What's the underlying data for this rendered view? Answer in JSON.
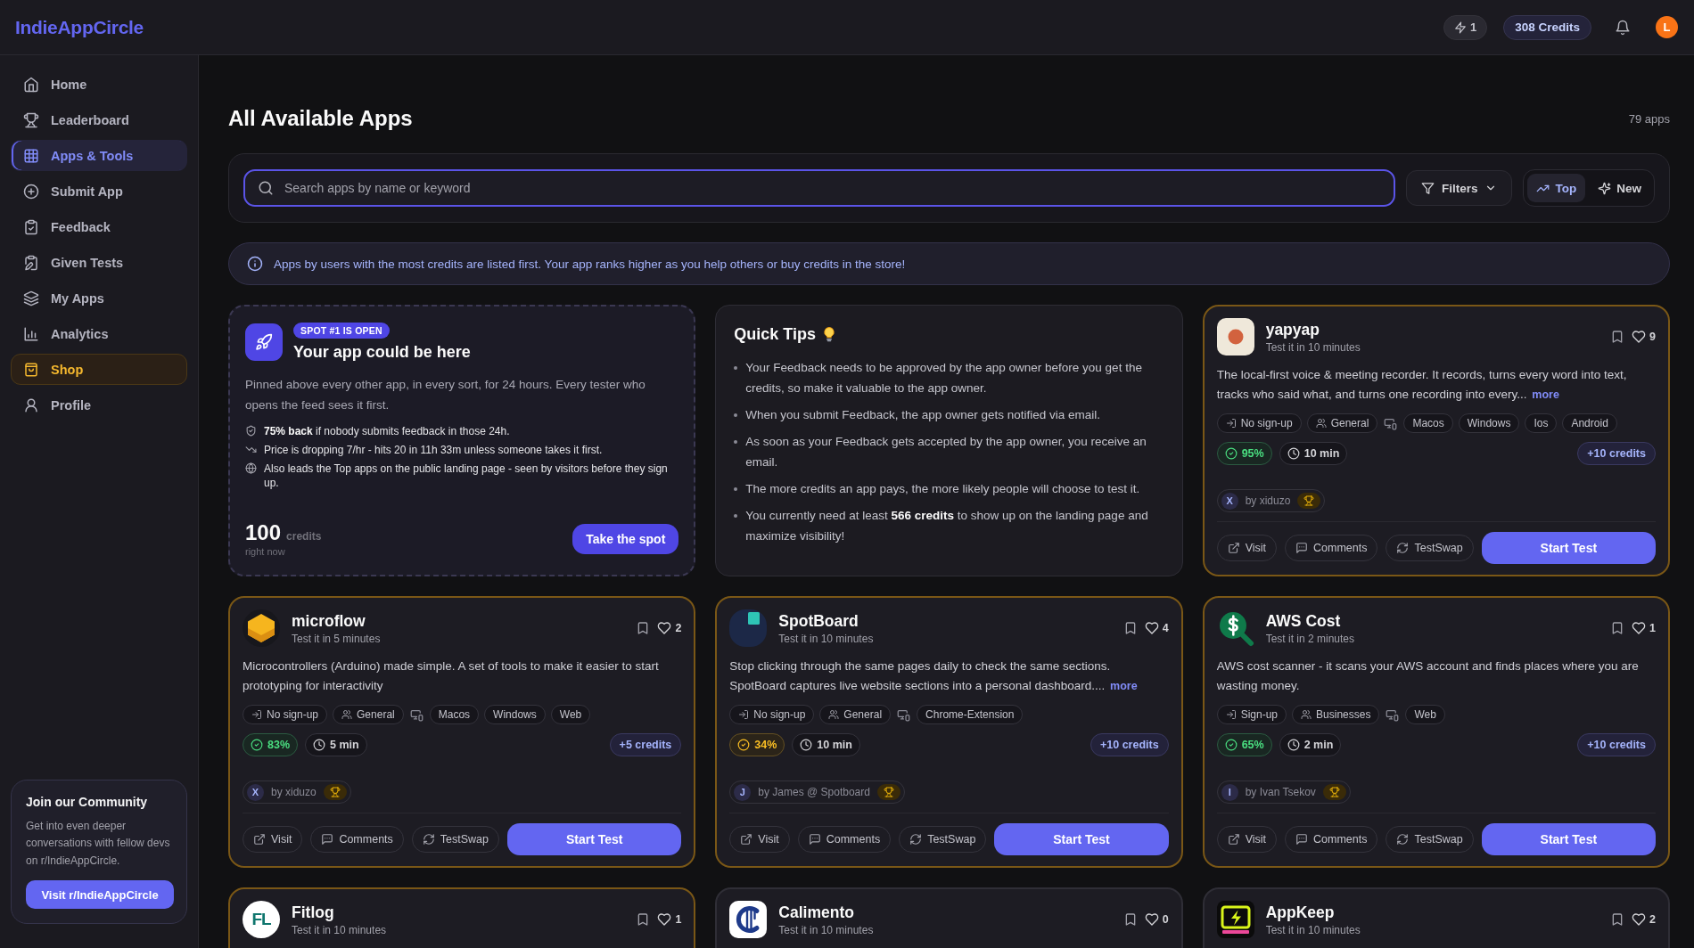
{
  "topbar": {
    "logo": "IndieAppCircle",
    "boost": "1",
    "credits": "308 Credits",
    "avatar": "L"
  },
  "sidebar": {
    "items": [
      {
        "label": "Home",
        "kind": "link",
        "selected": false
      },
      {
        "label": "Leaderboard",
        "kind": "link",
        "selected": false
      },
      {
        "label": "Apps & Tools",
        "kind": "link",
        "selected": true
      },
      {
        "label": "Submit App",
        "kind": "link",
        "selected": false
      },
      {
        "label": "Feedback",
        "kind": "link",
        "selected": false
      },
      {
        "label": "Given Tests",
        "kind": "link",
        "selected": false
      },
      {
        "label": "My Apps",
        "kind": "link",
        "selected": false
      },
      {
        "label": "Analytics",
        "kind": "link",
        "selected": false
      },
      {
        "label": "Shop",
        "kind": "accent",
        "selected": false
      },
      {
        "label": "Profile",
        "kind": "link",
        "selected": false
      }
    ],
    "community": {
      "title": "Join our Community",
      "text": "Get into even deeper conversations with fellow devs on r/IndieAppCircle.",
      "button": "Visit r/IndieAppCircle"
    }
  },
  "header": {
    "title": "All Available Apps",
    "count": "79 apps"
  },
  "search": {
    "placeholder": "Search apps by name or keyword"
  },
  "filters": {
    "label": "Filters"
  },
  "sort": [
    {
      "label": "Top",
      "selected": true
    },
    {
      "label": "New",
      "selected": false
    }
  ],
  "notice": "Apps by users with the most credits are listed first. Your app ranks higher as you help others or buy credits in the store!",
  "promo": {
    "badge": "SPOT #1 IS OPEN",
    "title": "Your app could be here",
    "description": "Pinned above every other app, in every sort, for 24 hours. Every tester who opens the feed sees it first.",
    "perks": [
      "**75% back** if nobody submits feedback in those 24h.",
      "Price is dropping 7/hr - hits 20 in 11h 33m unless someone takes it first.",
      "Also leads the Top apps on the public landing page - seen by visitors before they sign up."
    ],
    "price": "100",
    "price_unit": "credits",
    "price_note": "right now",
    "button": "Take the spot"
  },
  "quick_tips": {
    "title": "Quick Tips",
    "tips": [
      "Your Feedback needs to be approved by the app owner before you get the credits, so make it valuable to the app owner.",
      "When you submit Feedback, the app owner gets notified via email.",
      "As soon as your Feedback gets accepted by the app owner, you receive an email.",
      "The more credits an app pays, the more likely people will choose to test it.",
      "You currently need at least **566 credits** to show up on the landing page and maximize visibility!"
    ]
  },
  "apps": [
    {
      "name": "yapyap",
      "test_time": "Test it in 10 minutes",
      "likes": "9",
      "highlighted": true,
      "description": "The local-first voice & meeting recorder. It records, turns every word into text, tracks who said what, and turns one recording into every...",
      "more": "more",
      "access": "No sign-up",
      "audience": "General",
      "platforms": [
        "Macos",
        "Windows",
        "Ios",
        "Android"
      ],
      "rate": {
        "text": "95%",
        "color": "#4ade80"
      },
      "duration": "10 min",
      "reward": "+10 credits",
      "avatar_letter": "X",
      "author": "by xiduzo",
      "actions": [
        "Visit",
        "Comments",
        "TestSwap"
      ],
      "primary_action": "Start Test"
    },
    {
      "name": "microflow",
      "test_time": "Test it in 5 minutes",
      "likes": "2",
      "highlighted": true,
      "description": "Microcontrollers (Arduino) made simple. A set of tools to make it easier to start prototyping for interactivity",
      "access": "No sign-up",
      "audience": "General",
      "platforms": [
        "Macos",
        "Windows",
        "Web"
      ],
      "rate": {
        "text": "83%",
        "color": "#4ade80"
      },
      "duration": "5 min",
      "reward": "+5 credits",
      "avatar_letter": "X",
      "author": "by xiduzo",
      "actions": [
        "Visit",
        "Comments",
        "TestSwap"
      ],
      "primary_action": "Start Test"
    },
    {
      "name": "SpotBoard",
      "test_time": "Test it in 10 minutes",
      "likes": "4",
      "highlighted": true,
      "description": "Stop clicking through the same pages daily to check the same sections. SpotBoard captures live website sections into a personal dashboard....",
      "more": "more",
      "access": "No sign-up",
      "audience": "General",
      "platforms": [
        "Chrome-Extension"
      ],
      "rate": {
        "text": "34%",
        "color": "#fbbf24"
      },
      "duration": "10 min",
      "reward": "+10 credits",
      "avatar_letter": "J",
      "author": "by James @ Spotboard",
      "actions": [
        "Visit",
        "Comments",
        "TestSwap"
      ],
      "primary_action": "Start Test"
    },
    {
      "name": "AWS Cost",
      "test_time": "Test it in 2 minutes",
      "likes": "1",
      "highlighted": true,
      "description": "AWS cost scanner - it scans your AWS account and finds places where you are wasting money.",
      "access": "Sign-up",
      "audience": "Businesses",
      "platforms": [
        "Web"
      ],
      "rate": {
        "text": "65%",
        "color": "#4ade80"
      },
      "duration": "2 min",
      "reward": "+10 credits",
      "avatar_letter": "I",
      "author": "by Ivan Tsekov",
      "actions": [
        "Visit",
        "Comments",
        "TestSwap"
      ],
      "primary_action": "Start Test"
    },
    {
      "name": "Fitlog",
      "test_time": "Test it in 10 minutes",
      "likes": "1",
      "highlighted": true,
      "logo_text": "FL"
    },
    {
      "name": "Calimento",
      "test_time": "Test it in 10 minutes",
      "likes": "0",
      "highlighted": false
    },
    {
      "name": "AppKeep",
      "test_time": "Test it in 10 minutes",
      "likes": "2",
      "highlighted": false
    }
  ]
}
